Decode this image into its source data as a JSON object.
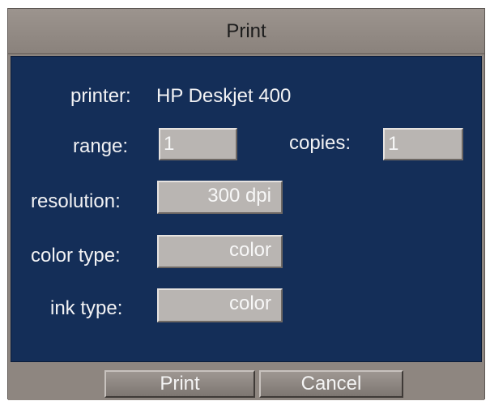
{
  "dialog": {
    "title": "Print"
  },
  "form": {
    "printer_label": "printer:",
    "printer_value": "HP Deskjet 400",
    "range_label": "range:",
    "range_value": "1",
    "copies_label": "copies:",
    "copies_value": "1",
    "resolution_label": "resolution:",
    "resolution_value": "300 dpi",
    "color_type_label": "color type:",
    "color_type_value": "color",
    "ink_type_label": "ink type:",
    "ink_type_value": "color"
  },
  "buttons": {
    "print_label": "Print",
    "cancel_label": "Cancel"
  }
}
